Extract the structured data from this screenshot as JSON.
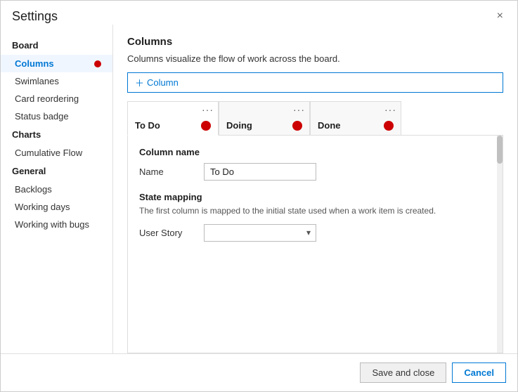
{
  "dialog": {
    "title": "Settings",
    "close_label": "×"
  },
  "sidebar": {
    "sections": [
      {
        "id": "board",
        "label": "Board",
        "items": []
      },
      {
        "id": "columns",
        "label": "Columns",
        "active": true,
        "has_error": true
      },
      {
        "id": "swimlanes",
        "label": "Swimlanes",
        "active": false
      },
      {
        "id": "card-reordering",
        "label": "Card reordering",
        "active": false
      },
      {
        "id": "status-badge",
        "label": "Status badge",
        "active": false
      },
      {
        "id": "charts",
        "label": "Charts",
        "is_section": true
      },
      {
        "id": "cumulative-flow",
        "label": "Cumulative Flow",
        "active": false
      },
      {
        "id": "general",
        "label": "General",
        "is_section": true
      },
      {
        "id": "backlogs",
        "label": "Backlogs",
        "active": false
      },
      {
        "id": "working-days",
        "label": "Working days",
        "active": false
      },
      {
        "id": "working-with-bugs",
        "label": "Working with bugs",
        "active": false
      }
    ]
  },
  "main": {
    "section_title": "Columns",
    "section_desc": "Columns visualize the flow of work across the board.",
    "add_column_label": "+ Column",
    "columns": [
      {
        "id": "todo",
        "label": "To Do",
        "active": true,
        "has_error": true
      },
      {
        "id": "doing",
        "label": "Doing",
        "active": false,
        "has_error": true
      },
      {
        "id": "done",
        "label": "Done",
        "active": false,
        "has_error": true
      }
    ],
    "panel": {
      "column_name_title": "Column name",
      "name_label": "Name",
      "name_value": "To Do",
      "state_mapping_title": "State mapping",
      "state_mapping_desc": "The first column is mapped to the initial state used when a work item is created.",
      "user_story_label": "User Story",
      "user_story_value": ""
    }
  },
  "footer": {
    "save_label": "Save and close",
    "cancel_label": "Cancel"
  }
}
